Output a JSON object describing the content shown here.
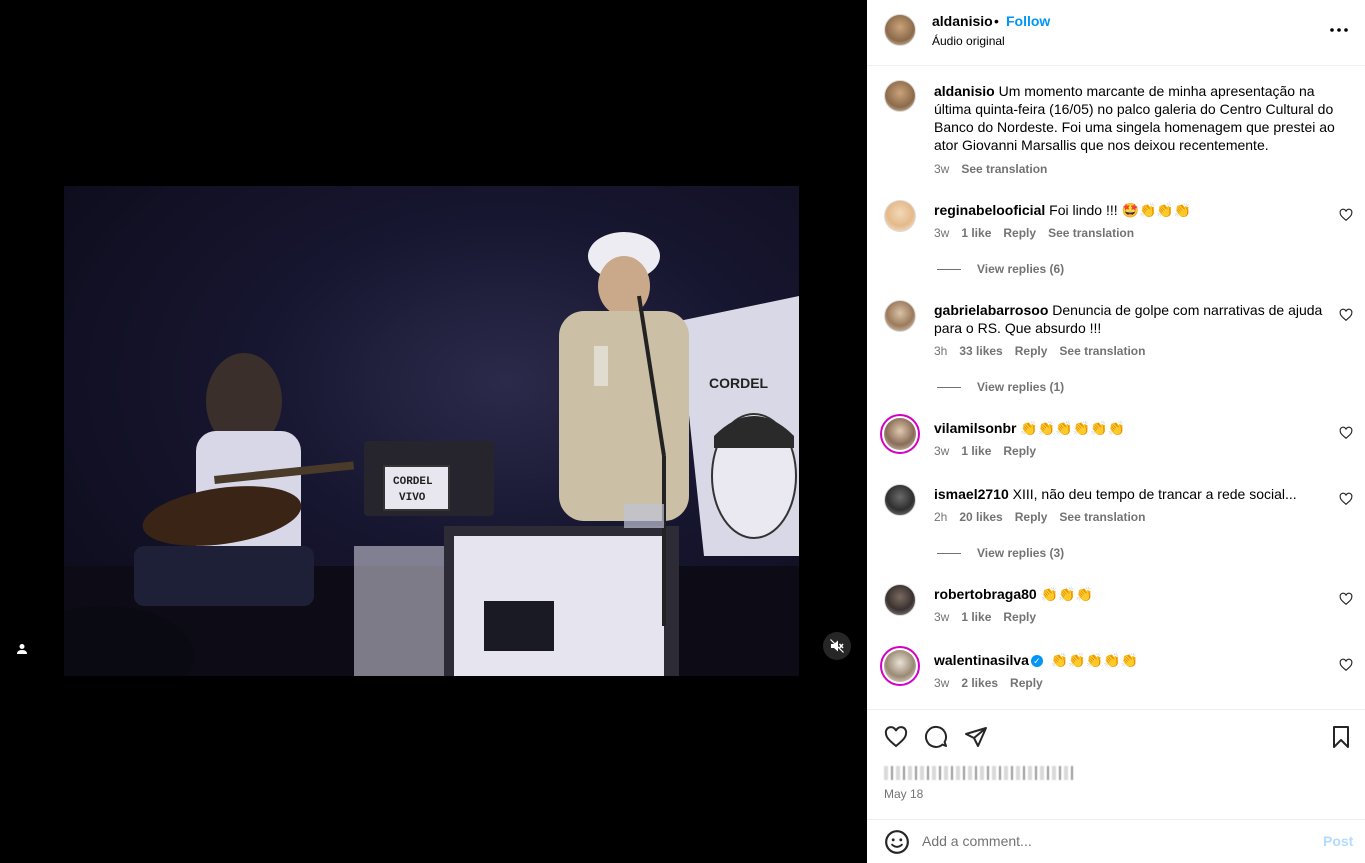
{
  "header": {
    "username": "aldanisio",
    "separator": "•",
    "follow_label": "Follow",
    "audio_label": "Áudio original",
    "more_icon": "more-horizontal-icon"
  },
  "caption": {
    "username": "aldanisio",
    "text": "Um momento marcante de minha apresentação na última quinta-feira (16/05) no palco galeria do Centro Cultural do Banco do Nordeste. Foi uma singela homenagem que prestei ao ator Giovanni Marsallis que nos deixou recentemente.",
    "time": "3w",
    "see_translation": "See translation"
  },
  "video": {
    "scene_text_1": "CORDEL VIVO",
    "scene_text_2": "CORDEL",
    "scene_text_3": "VIVO"
  },
  "comments": [
    {
      "username": "reginabelooficial",
      "text": "Foi lindo !!! 🤩👏👏👏",
      "time": "3w",
      "likes": "1 like",
      "reply": "Reply",
      "translate": "See translation",
      "view_replies": "View replies (6)"
    },
    {
      "username": "gabrielabarrosoo",
      "text": "Denuncia de golpe com narrativas de ajuda para o RS. Que absurdo !!!",
      "time": "3h",
      "likes": "33 likes",
      "reply": "Reply",
      "translate": "See translation",
      "view_replies": "View replies (1)"
    },
    {
      "username": "vilamilsonbr",
      "text": "👏👏👏👏👏👏",
      "time": "3w",
      "likes": "1 like",
      "reply": "Reply"
    },
    {
      "username": "ismael2710",
      "text": "XIII, não deu tempo de trancar a rede social...",
      "time": "2h",
      "likes": "20 likes",
      "reply": "Reply",
      "translate": "See translation",
      "view_replies": "View replies (3)"
    },
    {
      "username": "robertobraga80",
      "text": "👏👏👏",
      "time": "3w",
      "likes": "1 like",
      "reply": "Reply"
    },
    {
      "username": "walentinasilva",
      "text": "👏👏👏👏👏",
      "time": "3w",
      "likes": "2 likes",
      "reply": "Reply",
      "verified": true
    }
  ],
  "actions": {
    "date": "May 18"
  },
  "add_comment": {
    "placeholder": "Add a comment...",
    "post_label": "Post"
  },
  "colors": {
    "accent": "#0095f6",
    "secondary_text": "#737373",
    "post_disabled": "#b3dbff"
  }
}
